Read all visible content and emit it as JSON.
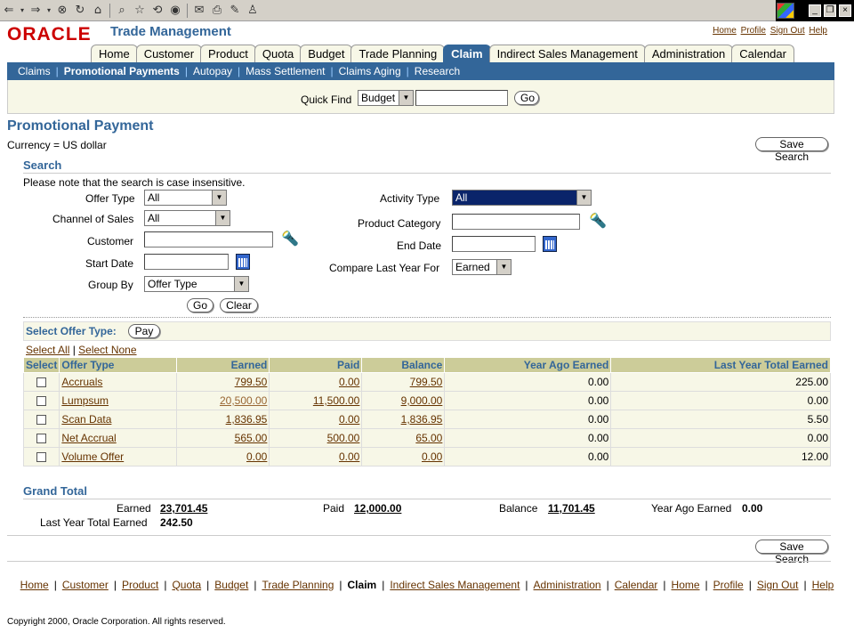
{
  "browser": {
    "icons": [
      "back-icon",
      "forward-icon",
      "stop-icon",
      "refresh-icon",
      "home-icon",
      "search-icon",
      "favorites-icon",
      "history-icon",
      "media-icon",
      "mail-icon",
      "print-icon",
      "edit-icon"
    ]
  },
  "header": {
    "logo": "ORACLE",
    "app_title": "Trade Management",
    "globals": [
      "Home",
      "Profile",
      "Sign Out",
      "Help"
    ]
  },
  "tabs": [
    "Home",
    "Customer",
    "Product",
    "Quota",
    "Budget",
    "Trade Planning",
    "Claim",
    "Indirect Sales Management",
    "Administration",
    "Calendar"
  ],
  "active_tab": "Claim",
  "subtabs": [
    "Claims",
    "Promotional Payments",
    "Autopay",
    "Mass Settlement",
    "Claims Aging",
    "Research"
  ],
  "active_subtab": "Promotional Payments",
  "quickfind": {
    "label": "Quick Find",
    "select": "Budget",
    "go": "Go"
  },
  "page": {
    "title": "Promotional Payment",
    "currency": "Currency = US dollar",
    "save_search": "Save Search"
  },
  "search": {
    "title": "Search",
    "note": "Please note that the search is case insensitive.",
    "offer_type_label": "Offer Type",
    "offer_type": "All",
    "channel_label": "Channel of Sales",
    "channel": "All",
    "customer_label": "Customer",
    "start_date_label": "Start Date",
    "group_by_label": "Group By",
    "group_by": "Offer Type",
    "activity_type_label": "Activity Type",
    "activity_type": "All",
    "product_category_label": "Product Category",
    "end_date_label": "End Date",
    "compare_label": "Compare Last Year For",
    "compare": "Earned",
    "go": "Go",
    "clear": "Clear"
  },
  "results": {
    "select_label": "Select Offer Type:",
    "pay": "Pay",
    "select_all": "Select All",
    "select_none": "Select None",
    "columns": [
      "Select",
      "Offer Type",
      "Earned",
      "Paid",
      "Balance",
      "Year Ago Earned",
      "Last Year Total Earned"
    ],
    "rows": [
      {
        "type": "Accruals",
        "earned": "799.50",
        "paid": "0.00",
        "balance": "799.50",
        "ya": "0.00",
        "ly": "225.00"
      },
      {
        "type": "Lumpsum",
        "earned": "20,500.00",
        "paid": "11,500.00",
        "balance": "9,000.00",
        "ya": "0.00",
        "ly": "0.00"
      },
      {
        "type": "Scan Data",
        "earned": "1,836.95",
        "paid": "0.00",
        "balance": "1,836.95",
        "ya": "0.00",
        "ly": "5.50"
      },
      {
        "type": "Net Accrual",
        "earned": "565.00",
        "paid": "500.00",
        "balance": "65.00",
        "ya": "0.00",
        "ly": "0.00"
      },
      {
        "type": "Volume Offer",
        "earned": "0.00",
        "paid": "0.00",
        "balance": "0.00",
        "ya": "0.00",
        "ly": "12.00"
      }
    ]
  },
  "grand_total": {
    "title": "Grand Total",
    "earned_label": "Earned",
    "earned": "23,701.45",
    "paid_label": "Paid",
    "paid": "12,000.00",
    "balance_label": "Balance",
    "balance": "11,701.45",
    "ya_label": "Year Ago Earned",
    "ya": "0.00",
    "ly_label": "Last Year Total Earned",
    "ly": "242.50"
  },
  "footer": {
    "links": [
      "Home",
      "Customer",
      "Product",
      "Quota",
      "Budget",
      "Trade Planning",
      "Claim",
      "Indirect Sales Management",
      "Administration",
      "Calendar",
      "Home",
      "Profile",
      "Sign Out",
      "Help"
    ],
    "copyright": "Copyright 2000, Oracle Corporation. All rights reserved."
  },
  "colors": {
    "brand_red": "#cc0000",
    "accent_blue": "#336699",
    "link": "#663300",
    "table_header": "#cccc99",
    "row_bg": "#f7f7e7"
  }
}
